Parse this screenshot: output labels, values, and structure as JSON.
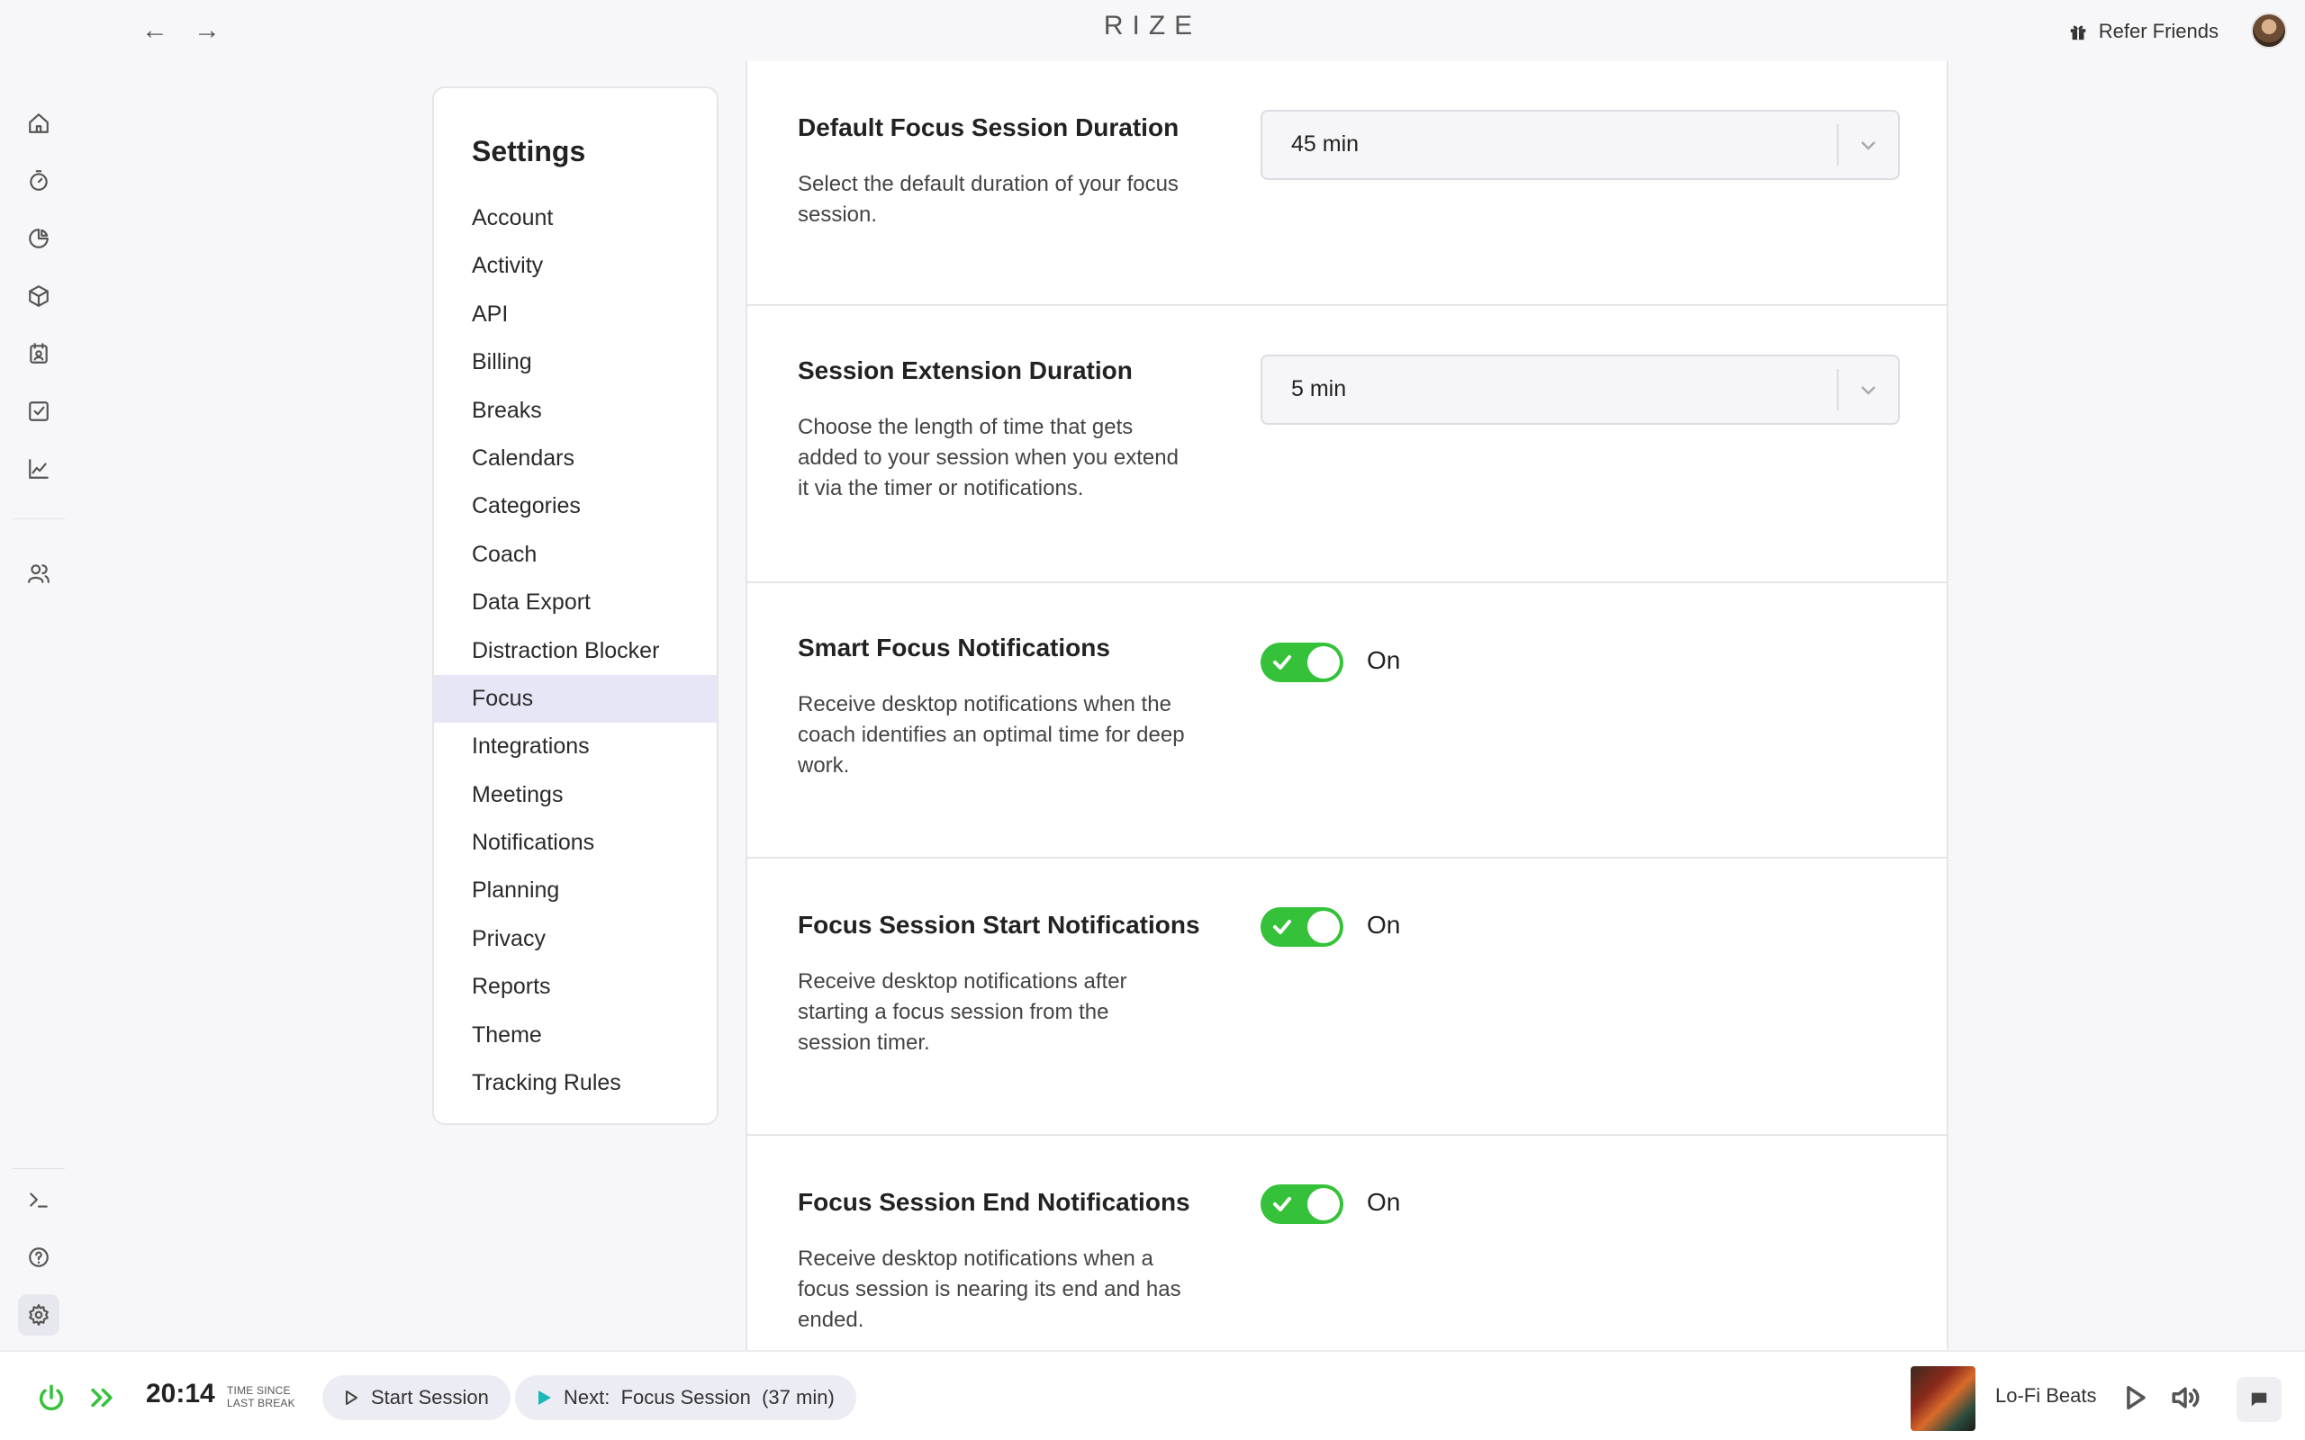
{
  "app": {
    "logo": "RIZE"
  },
  "topbar": {
    "refer_label": "Refer Friends"
  },
  "rail": {
    "items": [
      "home-icon",
      "timer-icon",
      "pie-chart-icon",
      "cube-icon",
      "calendar-icon",
      "checkbox-icon",
      "line-chart-icon",
      "users-icon",
      "terminal-icon",
      "help-icon",
      "gear-icon"
    ]
  },
  "settings": {
    "title": "Settings",
    "menu": [
      "Account",
      "Activity",
      "API",
      "Billing",
      "Breaks",
      "Calendars",
      "Categories",
      "Coach",
      "Data Export",
      "Distraction Blocker",
      "Focus",
      "Integrations",
      "Meetings",
      "Notifications",
      "Planning",
      "Privacy",
      "Reports",
      "Theme",
      "Tracking Rules"
    ],
    "active": "Focus"
  },
  "sections": {
    "default_duration": {
      "title": "Default Focus Session Duration",
      "desc": "Select the default duration of your focus session.",
      "value": "45 min"
    },
    "extension_duration": {
      "title": "Session Extension Duration",
      "desc": "Choose the length of time that gets added to your session when you extend it via the timer or notifications.",
      "value": "5 min"
    },
    "smart_focus": {
      "title": "Smart Focus Notifications",
      "desc": "Receive desktop notifications when the coach identifies an optimal time for deep work.",
      "state": "On"
    },
    "start_notifications": {
      "title": "Focus Session Start Notifications",
      "desc": "Receive desktop notifications after starting a focus session from the session timer.",
      "state": "On"
    },
    "end_notifications": {
      "title": "Focus Session End Notifications",
      "desc": "Receive desktop notifications when a focus session is nearing its end and has ended.",
      "state": "On"
    }
  },
  "bottombar": {
    "timer": "20:14",
    "timer_caption_1": "TIME SINCE",
    "timer_caption_2": "LAST BREAK",
    "start_session": "Start Session",
    "next_session": "Next:  Focus Session  (37 min)",
    "track": "Lo-Fi Beats"
  },
  "colors": {
    "toggle_on": "#35c23a",
    "active_menu": "#e7e6f7"
  }
}
